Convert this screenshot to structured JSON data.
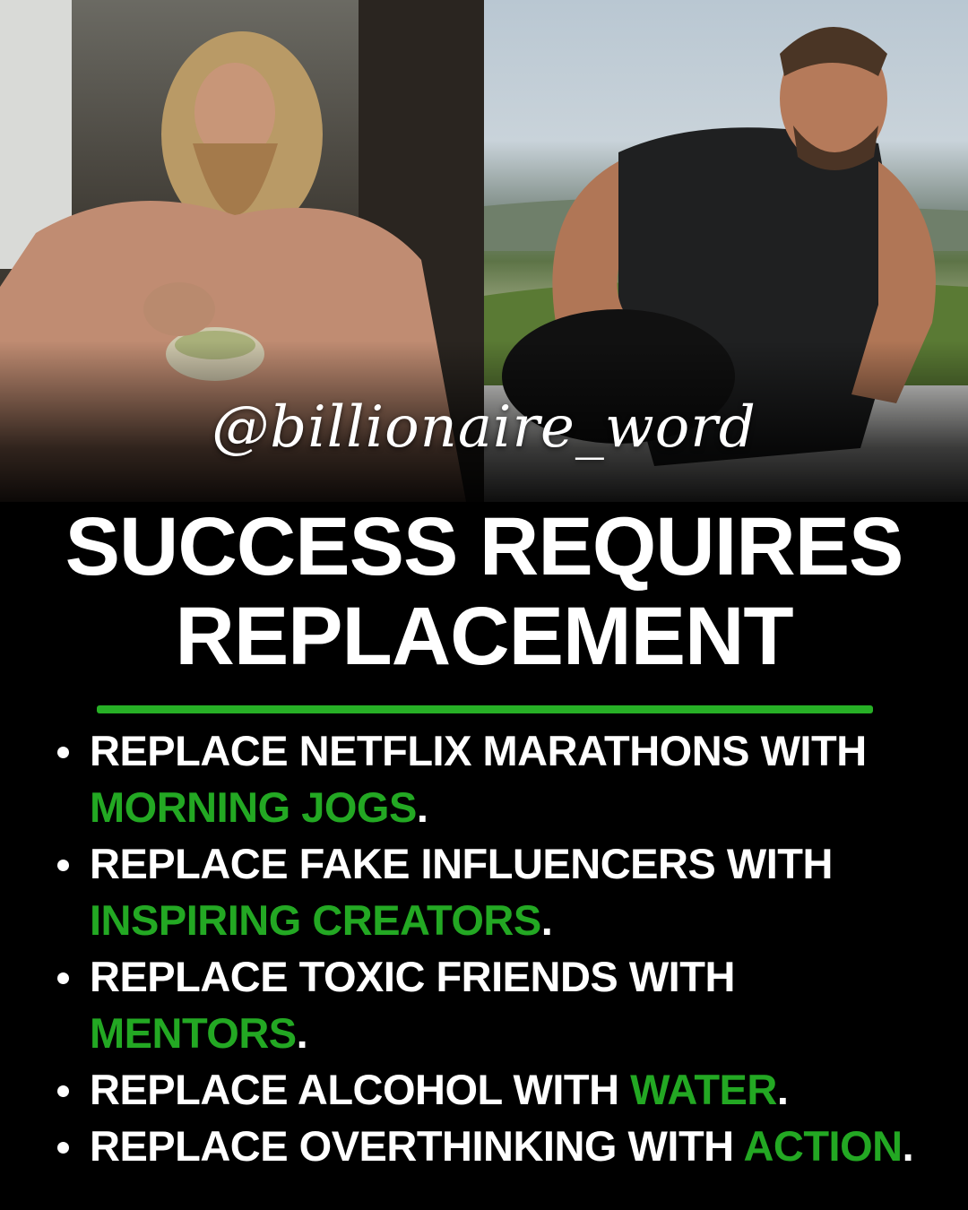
{
  "handle": "@billionaire_word",
  "title": {
    "line1": "SUCCESS REQUIRES",
    "line2": "REPLACEMENT"
  },
  "accent_color": "#23a823",
  "bullets": [
    {
      "text": "REPLACE NETFLIX MARATHONS WITH ",
      "highlight": "MORNING JOGS",
      "end": "."
    },
    {
      "text": "REPLACE FAKE INFLUENCERS WITH ",
      "highlight": "INSPIRING CREATORS",
      "end": "."
    },
    {
      "text": "REPLACE TOXIC FRIENDS WITH ",
      "highlight": "MENTORS",
      "end": "."
    },
    {
      "text": "REPLACE ALCOHOL WITH ",
      "highlight": "WATER",
      "end": "."
    },
    {
      "text": "REPLACE OVERTHINKING WITH ",
      "highlight": "ACTION",
      "end": "."
    }
  ]
}
